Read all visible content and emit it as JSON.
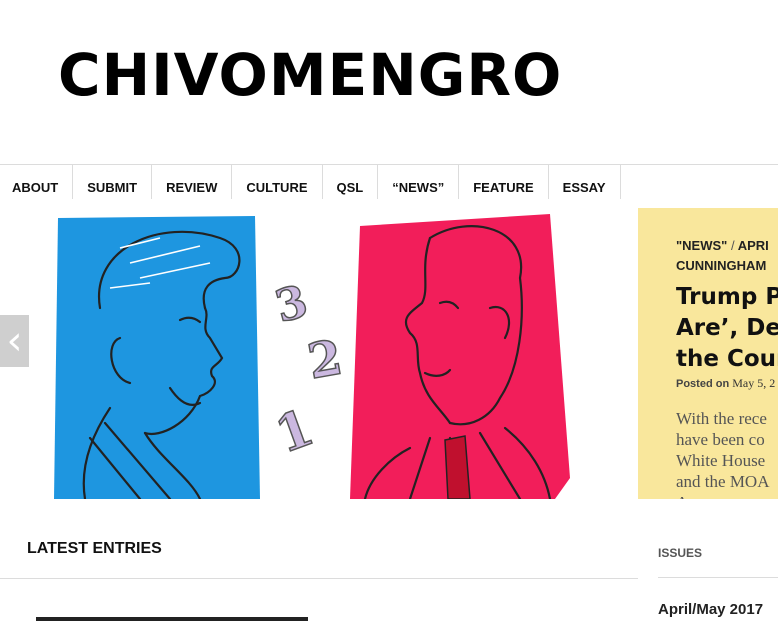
{
  "site": {
    "title": "CHIVOMENGRO"
  },
  "nav": {
    "items": [
      {
        "label": "ABOUT"
      },
      {
        "label": "SUBMIT"
      },
      {
        "label": "REVIEW"
      },
      {
        "label": "CULTURE"
      },
      {
        "label": "QSL"
      },
      {
        "label": "“NEWS”"
      },
      {
        "label": "FEATURE"
      },
      {
        "label": "ESSAY"
      }
    ]
  },
  "slider": {
    "image": {
      "left_panel_color": "#1e96e0",
      "right_panel_color": "#f21e5a",
      "numbers": [
        "3",
        "2",
        "1"
      ]
    },
    "prev_arrow": "‹"
  },
  "featured_post": {
    "category_line_1": "\"NEWS\"",
    "separator": "/",
    "category_line_1_rest": "APRI",
    "category_line_2": "CUNNINGHAM",
    "title_lines": [
      "Trump P",
      "Are’, Des",
      "the Cour"
    ],
    "posted_on_label": "Posted on",
    "date": "May 5, 2",
    "excerpt_lines": [
      "With the rece",
      "have been co",
      "White House",
      "and the MOA",
      "A"
    ],
    "panel_color": "#f9e79c"
  },
  "latest": {
    "heading": "LATEST ENTRIES"
  },
  "sidebar": {
    "issues_heading": "ISSUES",
    "issues": [
      {
        "label": "April/May 2017"
      }
    ]
  }
}
